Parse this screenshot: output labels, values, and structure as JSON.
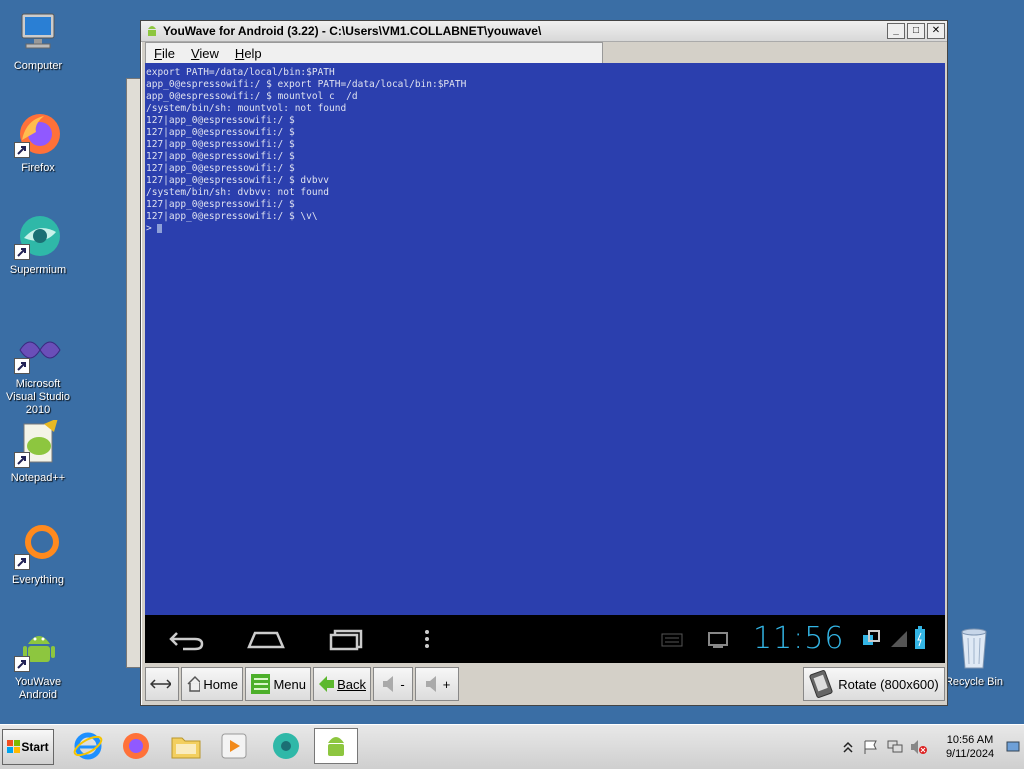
{
  "desktop_icons": [
    {
      "label": "Computer",
      "icon": "computer-icon"
    },
    {
      "label": "Firefox",
      "icon": "firefox-icon"
    },
    {
      "label": "Supermium",
      "icon": "supermium-icon"
    },
    {
      "label": "Microsoft Visual Studio 2010",
      "icon": "visual-studio-icon"
    },
    {
      "label": "Notepad++",
      "icon": "notepad-plus-plus-icon"
    },
    {
      "label": "Everything",
      "icon": "everything-search-icon"
    },
    {
      "label": "YouWave Android",
      "icon": "youwave-android-icon"
    },
    {
      "label": "Recycle Bin",
      "icon": "recycle-bin-icon"
    }
  ],
  "window": {
    "title": "YouWave for Android (3.22) - C:\\Users\\VM1.COLLABNET\\youwave\\",
    "menu": [
      "File",
      "View",
      "Help"
    ]
  },
  "terminal": {
    "lines": [
      "export PATH=/data/local/bin:$PATH",
      "app_0@espressowifi:/ $ export PATH=/data/local/bin:$PATH",
      "app_0@espressowifi:/ $ mountvol c  /d",
      "/system/bin/sh: mountvol: not found",
      "127|app_0@espressowifi:/ $",
      "127|app_0@espressowifi:/ $",
      "127|app_0@espressowifi:/ $",
      "127|app_0@espressowifi:/ $",
      "127|app_0@espressowifi:/ $",
      "127|app_0@espressowifi:/ $ dvbvv",
      "/system/bin/sh: dvbvv: not found",
      "127|app_0@espressowifi:/ $",
      "127|app_0@espressowifi:/ $ \\v\\",
      "> "
    ]
  },
  "android_status": {
    "clock": "11:56"
  },
  "toolbar": {
    "home": "Home",
    "menu": "Menu",
    "back": "Back",
    "vol_down": "-",
    "vol_up": "+",
    "rotate": "Rotate (800x600)"
  },
  "taskbar": {
    "start": "Start",
    "time": "10:56 AM",
    "date": "9/11/2024"
  },
  "colors": {
    "desktop": "#3a6ea5",
    "android_screen": "#2b3fae",
    "clock": "#33b5e5"
  }
}
